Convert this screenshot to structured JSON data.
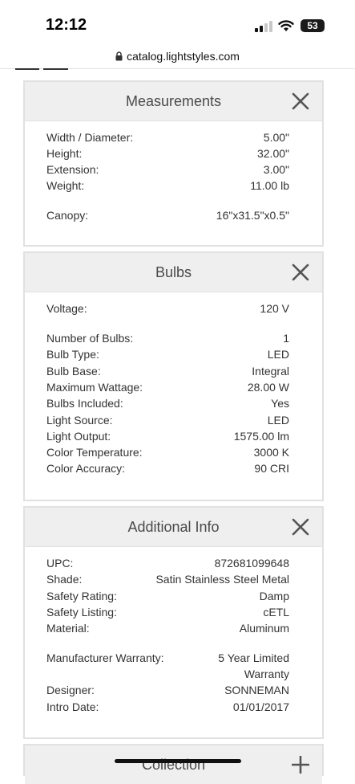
{
  "status": {
    "time": "12:12",
    "battery": "53"
  },
  "browser": {
    "url": "catalog.lightstyles.com"
  },
  "sections": {
    "measurements": {
      "title": "Measurements",
      "rows": [
        {
          "label": "Width / Diameter:",
          "value": "5.00\""
        },
        {
          "label": "Height:",
          "value": "32.00\""
        },
        {
          "label": "Extension:",
          "value": "3.00\""
        },
        {
          "label": "Weight:",
          "value": "11.00 lb"
        },
        {
          "label": "Canopy:",
          "value": "16\"x31.5\"x0.5\""
        }
      ]
    },
    "bulbs": {
      "title": "Bulbs",
      "rows": [
        {
          "label": "Voltage:",
          "value": "120 V"
        },
        {
          "label": "Number of Bulbs:",
          "value": "1"
        },
        {
          "label": "Bulb Type:",
          "value": "LED"
        },
        {
          "label": "Bulb Base:",
          "value": "Integral"
        },
        {
          "label": "Maximum Wattage:",
          "value": "28.00 W"
        },
        {
          "label": "Bulbs Included:",
          "value": "Yes"
        },
        {
          "label": "Light Source:",
          "value": "LED"
        },
        {
          "label": "Light Output:",
          "value": "1575.00 lm"
        },
        {
          "label": "Color Temperature:",
          "value": "3000 K"
        },
        {
          "label": "Color Accuracy:",
          "value": "90 CRI"
        }
      ]
    },
    "additional": {
      "title": "Additional Info",
      "rows": [
        {
          "label": "UPC:",
          "value": "872681099648"
        },
        {
          "label": "Shade:",
          "value": "Satin Stainless Steel Metal"
        },
        {
          "label": "Safety Rating:",
          "value": "Damp"
        },
        {
          "label": "Safety Listing:",
          "value": "cETL"
        },
        {
          "label": "Material:",
          "value": "Aluminum"
        },
        {
          "label": "Manufacturer Warranty:",
          "value": "5 Year Limited",
          "value2": "Warranty"
        },
        {
          "label": "Designer:",
          "value": "SONNEMAN"
        },
        {
          "label": "Intro Date:",
          "value": "01/01/2017"
        }
      ]
    },
    "collection": {
      "title": "Collection"
    }
  }
}
